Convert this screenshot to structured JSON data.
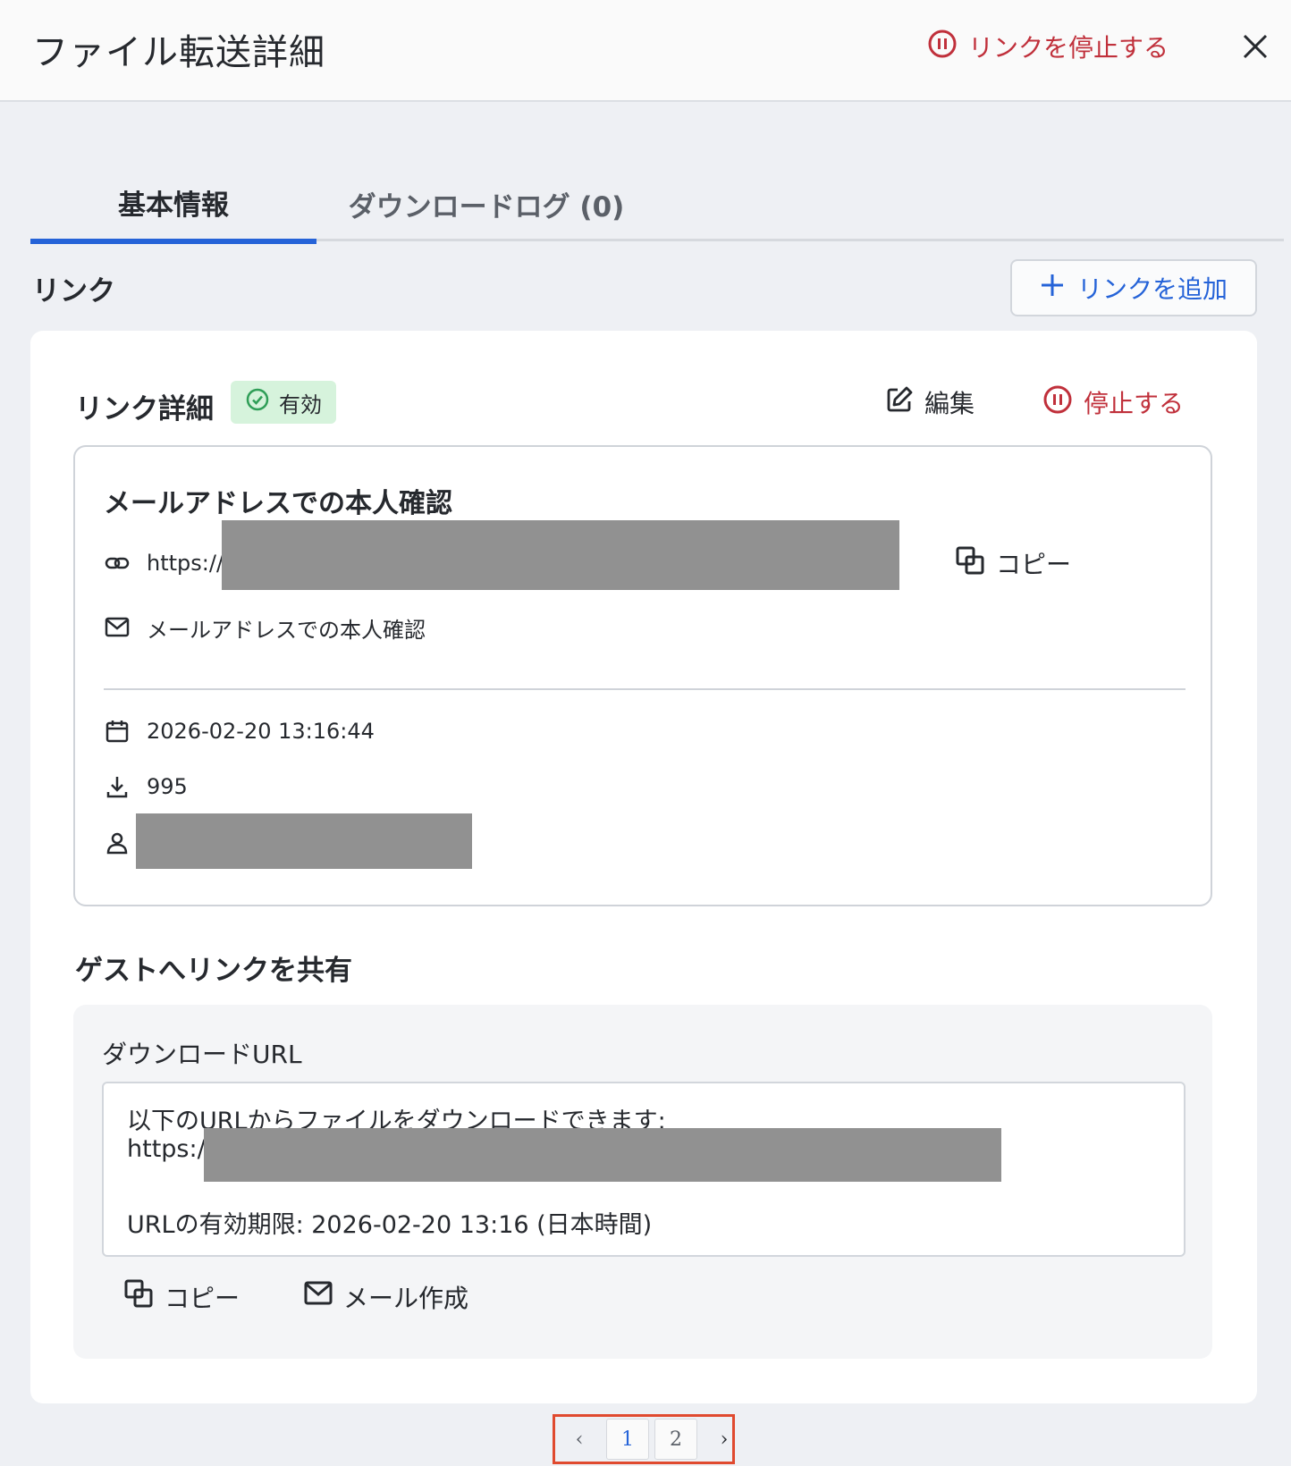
{
  "header": {
    "title": "ファイル転送詳細",
    "stop_link_label": "リンクを停止する"
  },
  "tabs": [
    {
      "label": "基本情報",
      "active": true
    },
    {
      "label": "ダウンロードログ (0)",
      "active": false
    }
  ],
  "links_section": {
    "title": "リンク",
    "add_link_label": "リンクを追加"
  },
  "link_detail": {
    "title": "リンク詳細",
    "status_badge": "有効",
    "edit_label": "編集",
    "stop_label": "停止する",
    "auth": {
      "title": "メールアドレスでの本人確認",
      "url_prefix": "https://c",
      "copy_label": "コピー",
      "auth_method": "メールアドレスでの本人確認",
      "expiry": "2026-02-20 13:16:44",
      "download_count": "995"
    }
  },
  "guest_share": {
    "title": "ゲストへリンクを共有",
    "download_url_label": "ダウンロードURL",
    "message_line1": "以下のURLからファイルをダウンロードできます:",
    "message_url_prefix": "https://",
    "message_expiry": "URLの有効期限: 2026-02-20 13:16 (日本時間)",
    "copy_label": "コピー",
    "compose_mail_label": "メール作成"
  },
  "pagination": {
    "prev": "‹",
    "pages": [
      "1",
      "2"
    ],
    "current_page": "1",
    "next": "›"
  },
  "colors": {
    "accent": "#2563d8",
    "danger": "#c0303b",
    "success_badge_bg": "#d6f3dc",
    "redaction": "#919191",
    "highlight_frame": "#e04a2f"
  }
}
